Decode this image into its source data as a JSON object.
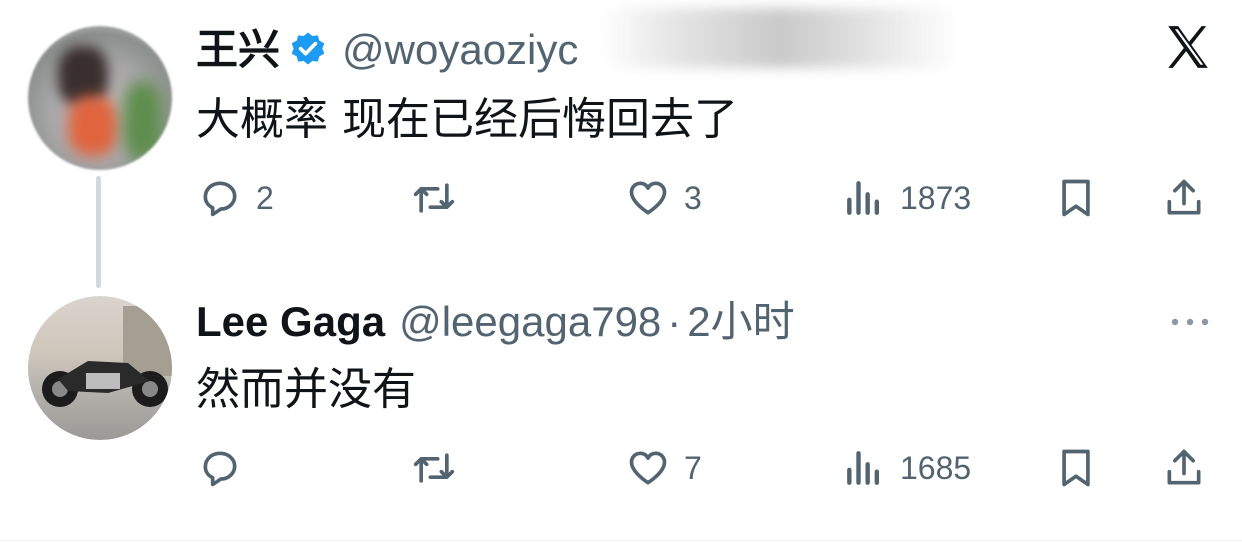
{
  "tweets": [
    {
      "author_name": "王兴",
      "handle": "@woyaoziyc",
      "verified": true,
      "text": "大概率 现在已经后悔回去了",
      "replies": "2",
      "retweets": "",
      "likes": "3",
      "views": "1873"
    },
    {
      "author_name": "Lee Gaga",
      "handle": "@leegaga798",
      "separator": "·",
      "time": "2小时",
      "text": "然而并没有",
      "replies": "",
      "retweets": "",
      "likes": "7",
      "views": "1685"
    }
  ],
  "icons": {
    "reply": "reply-icon",
    "retweet": "retweet-icon",
    "like": "heart-icon",
    "views": "views-icon",
    "bookmark": "bookmark-icon",
    "share": "share-icon",
    "logo": "x-logo-icon",
    "more": "more-icon",
    "verified": "verified-badge-icon"
  },
  "colors": {
    "text": "#0f1419",
    "secondary": "#536471",
    "verified": "#1d9bf0",
    "thread_line": "#cfd9de"
  }
}
